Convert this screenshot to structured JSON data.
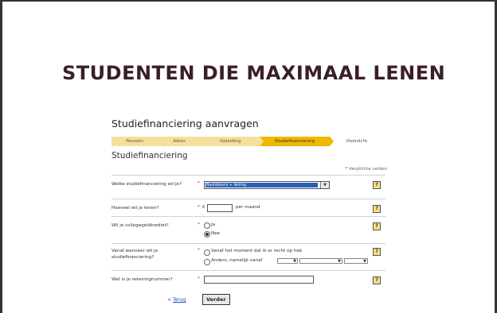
{
  "slide": {
    "title": "STUDENTEN DIE MAXIMAAL LENEN"
  },
  "form": {
    "header": "Studiefinanciering aanvragen",
    "steps": [
      {
        "label": "Persoon"
      },
      {
        "label": "Adres"
      },
      {
        "label": "Opleiding"
      },
      {
        "label": "Studiefinanciering"
      },
      {
        "label": "Overzicht"
      }
    ],
    "section_title": "Studiefinanciering",
    "required_note": "Verplichte velden",
    "required_star": "*",
    "help_symbol": "?",
    "q1": {
      "label": "Welke studiefinanciering wil je?",
      "selected": "Basisbeurs + lening",
      "arrow": "▼"
    },
    "q2": {
      "label": "Hoeveel wil je lenen?",
      "currency": "€",
      "suffix": "per maand"
    },
    "q3": {
      "label": "Wil je collegegeldkrediet?",
      "option_yes": "Ja",
      "option_no": "Nee",
      "selected": "Nee"
    },
    "q4": {
      "label": "Vanaf wanneer wil je studiefinanciering?",
      "option_1": "Vanaf het moment dat ik er recht op heb",
      "option_2": "Anders, namelijk vanaf",
      "dropdown_arrow": "▼"
    },
    "q5": {
      "label": "Wat is je rekeningnummer?"
    },
    "back_link": "Terug",
    "back_prefix": "<",
    "next_button": "Verder"
  }
}
